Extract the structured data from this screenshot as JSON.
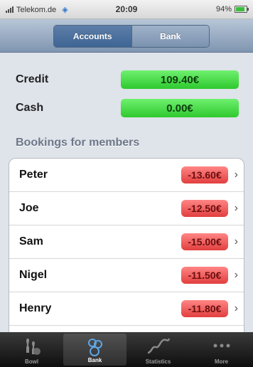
{
  "status_bar": {
    "carrier": "Telekom.de",
    "time": "20:09",
    "battery": "94%"
  },
  "nav": {
    "segments": [
      "Accounts",
      "Bank"
    ],
    "selected": "Accounts"
  },
  "summary": {
    "credit_label": "Credit",
    "credit_value": "109.40€",
    "cash_label": "Cash",
    "cash_value": "0.00€"
  },
  "section_title": "Bookings for members",
  "bookings": [
    {
      "name": "Peter",
      "amount": "-13.60€"
    },
    {
      "name": "Joe",
      "amount": "-12.50€"
    },
    {
      "name": "Sam",
      "amount": "-15.00€"
    },
    {
      "name": "Nigel",
      "amount": "-11.50€"
    },
    {
      "name": "Henry",
      "amount": "-11.80€"
    }
  ],
  "tab_bar": {
    "items": [
      {
        "label": "Bowl",
        "icon": "pins-icon"
      },
      {
        "label": "Bank",
        "icon": "coins-icon"
      },
      {
        "label": "Statistics",
        "icon": "graph-icon"
      },
      {
        "label": "More",
        "icon": "more-icon"
      }
    ],
    "selected": "Bank"
  },
  "colors": {
    "credit_green": "#3cd93c",
    "debit_red": "#f05555",
    "nav_blue": "#4a6fa0"
  }
}
